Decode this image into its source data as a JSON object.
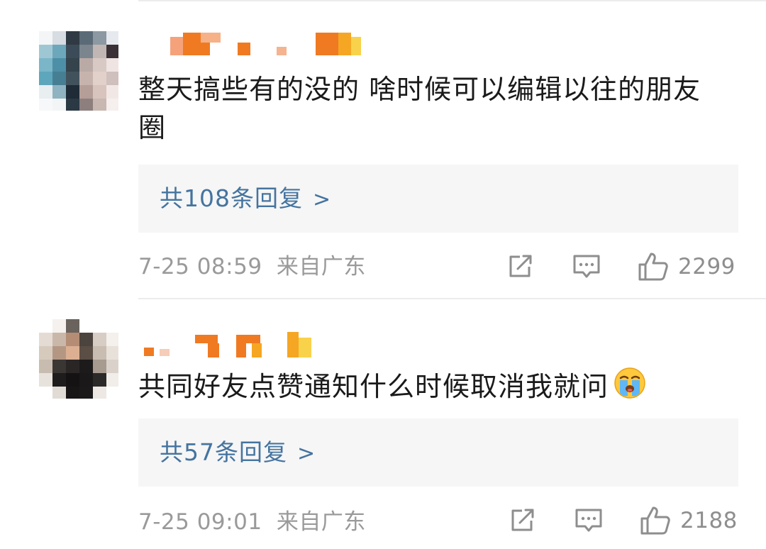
{
  "comments": [
    {
      "avatar_pixels": [
        [
          "#f4f5f6",
          "#d7dde2",
          "#2f3a44",
          "#5b6a77",
          "#8c98a2",
          "#e6eaee"
        ],
        [
          "#9fc7d3",
          "#6da7bb",
          "#3b4c58",
          "#7b858d",
          "#c2b6b4",
          "#3a3036"
        ],
        [
          "#7ab6c8",
          "#4d8fa6",
          "#35434c",
          "#b9aaa6",
          "#d8c9c5",
          "#efe4e2"
        ],
        [
          "#5ea6bb",
          "#467f93",
          "#42525c",
          "#c7b3ad",
          "#e2d1cb",
          "#cfc0bd"
        ],
        [
          "#e9eef0",
          "#8fb3c1",
          "#1f2c37",
          "#b59e98",
          "#d8c3bd",
          "#f1e8e6"
        ],
        [
          "#f7f8f9",
          "#f3f4f5",
          "#2b3945",
          "#8d7f7d",
          "#c9b7b2",
          "#f5efee"
        ]
      ],
      "username_colors": [
        "#f07a22",
        "#f5a623",
        "#f8d24a"
      ],
      "text": "整天搞些有的没的 啥时候可以编辑以往的朋友圈",
      "emoji": "",
      "replies_label": "共108条回复",
      "replies_arrow": ">",
      "time": "7-25 08:59",
      "location": "来自广东",
      "like_count": "2299",
      "icons": {
        "share": "share-icon",
        "comment": "comment-icon",
        "like": "like-icon"
      }
    },
    {
      "avatar_pixels": [
        [
          "#ffffff",
          "#f5f1ee",
          "#6a625c",
          "#ffffff",
          "#ffffff",
          "#ffffff"
        ],
        [
          "#e4dcd4",
          "#c9b8aa",
          "#b58c74",
          "#4b433d",
          "#d7cdc4",
          "#f4f0ec"
        ],
        [
          "#d6cabd",
          "#b49783",
          "#dcaf92",
          "#5a4e45",
          "#c9bdb1",
          "#e8e1da"
        ],
        [
          "#c8bcb0",
          "#3a3634",
          "#2a2626",
          "#1c1a1a",
          "#a79b90",
          "#dad2ca"
        ],
        [
          "#e8e2dc",
          "#1e1c1c",
          "#141212",
          "#1a1818",
          "#2c2a29",
          "#f1ede9"
        ],
        [
          "#ffffff",
          "#e1dbd5",
          "#171515",
          "#1b1919",
          "#ede8e4",
          "#ffffff"
        ]
      ],
      "username_colors": [
        "#f07a22",
        "#f5a623",
        "#f8d24a"
      ],
      "text": "共同好友点赞通知什么时候取消我就问",
      "emoji": "loudly-crying-face",
      "replies_label": "共57条回复",
      "replies_arrow": ">",
      "time": "7-25 09:01",
      "location": "来自广东",
      "like_count": "2188",
      "icons": {
        "share": "share-icon",
        "comment": "comment-icon",
        "like": "like-icon"
      }
    }
  ],
  "colors": {
    "link": "#45749f",
    "meta": "#9a9a9a",
    "text": "#1a1a1a",
    "reply_bg": "#f6f6f6"
  }
}
